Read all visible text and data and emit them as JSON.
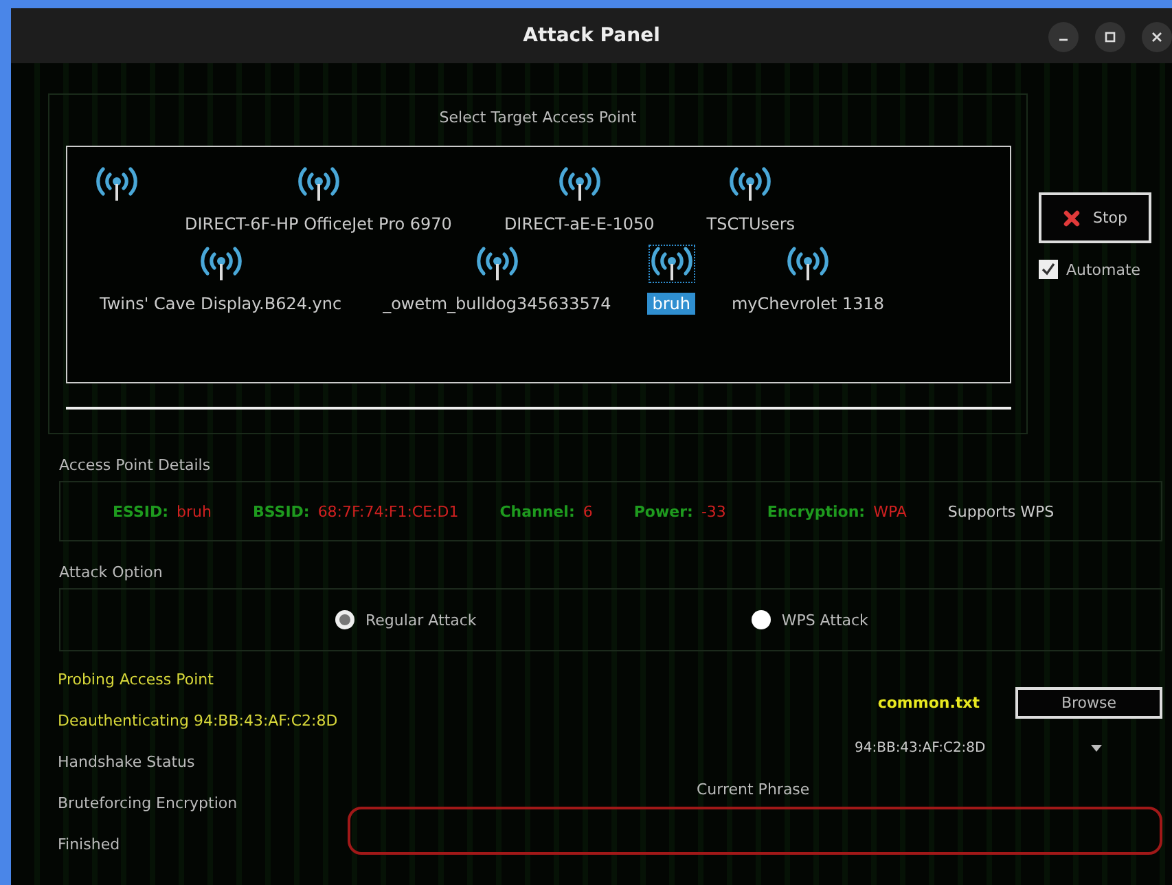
{
  "window": {
    "title": "Attack Panel"
  },
  "target_section": {
    "title": "Select Target Access Point",
    "rows": [
      {
        "access_points": [
          {
            "selected": false
          },
          {
            "name": "DIRECT-6F-HP OfficeJet Pro 6970",
            "selected": false
          },
          {
            "name": "DIRECT-aE-E-1050",
            "selected": false
          },
          {
            "name": "TSCTUsers",
            "selected": false
          }
        ]
      },
      {
        "access_points": [
          {
            "name": "Twins' Cave Display.B624.ync",
            "selected": false
          },
          {
            "name": "_owetm_bulldog345633574",
            "selected": false
          },
          {
            "name": "bruh",
            "selected": true
          },
          {
            "name": "myChevrolet 1318",
            "selected": false
          }
        ]
      }
    ]
  },
  "stop_button": {
    "label": "Stop"
  },
  "automate": {
    "label": "Automate",
    "checked": true
  },
  "details": {
    "title": "Access Point Details",
    "fields": [
      {
        "label": "ESSID:",
        "value": "bruh"
      },
      {
        "label": "BSSID:",
        "value": "68:7F:74:F1:CE:D1"
      },
      {
        "label": "Channel:",
        "value": "6"
      },
      {
        "label": "Power:",
        "value": "-33"
      },
      {
        "label": "Encryption:",
        "value": "WPA"
      }
    ],
    "note": "Supports WPS"
  },
  "attack_option": {
    "title": "Attack Option",
    "options": [
      {
        "label": "Regular Attack",
        "selected": true
      },
      {
        "label": "WPS  Attack",
        "selected": false
      }
    ]
  },
  "stages": [
    {
      "label": "Probing Access Point",
      "active": true
    },
    {
      "label": "Deauthenticating 94:BB:43:AF:C2:8D",
      "active": true
    },
    {
      "label": "Handshake Status",
      "active": false
    },
    {
      "label": "Bruteforcing Encryption",
      "active": false
    },
    {
      "label": "Finished",
      "active": false
    }
  ],
  "wordlist": {
    "file": "common.txt",
    "button": "Browse"
  },
  "client_dropdown": {
    "value": "94:BB:43:AF:C2:8D"
  },
  "current_phrase": {
    "label": "Current Phrase"
  }
}
